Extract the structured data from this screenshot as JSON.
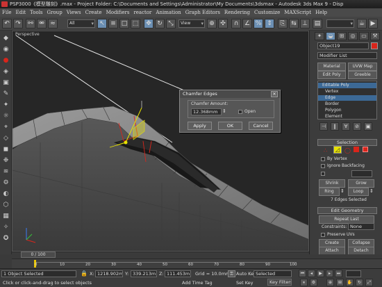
{
  "window": {
    "title": "PSP3000《模型雕刻》.max  - Project Folder: C:\\Documents and Settings\\Administrator\\My Documents\\3dsmax  - Autodesk 3ds Max 9  - Disp"
  },
  "menu": [
    "File",
    "Edit",
    "Tools",
    "Group",
    "Views",
    "Create",
    "Modifiers",
    "reactor",
    "Animation",
    "Graph Editors",
    "Rendering",
    "Customize",
    "MAXScript",
    "Help"
  ],
  "toolbar": {
    "selection_filter": "All",
    "ref_coord": "View"
  },
  "viewport": {
    "label": "Perspective"
  },
  "dialog": {
    "title": "Chamfer Edges",
    "amount_label": "Chamfer Amount:",
    "amount_value": "12.368mm",
    "open_label": "Open",
    "apply_label": "Apply",
    "ok_label": "OK",
    "cancel_label": "Cancel"
  },
  "panel": {
    "object_name": "Object19",
    "modifier_list": "Modifier List",
    "buttons": {
      "material": "Material",
      "uvw_map": "UVW Map",
      "edit_poly": "Edit Poly",
      "greeble": "Greeble"
    },
    "stack": [
      "Editable Poly",
      "Vertex",
      "Edge",
      "Border",
      "Polygon",
      "Element"
    ],
    "selection": {
      "header": "Selection",
      "by_vertex": "By Vertex",
      "ignore_backfacing": "Ignore Backfacing",
      "shrink": "Shrink",
      "grow": "Grow",
      "ring": "Ring",
      "loop": "Loop",
      "status": "7 Edges Selected"
    },
    "edit_geometry": {
      "header": "Edit Geometry",
      "repeat_last": "Repeat Last",
      "constraints_label": "Constraints:",
      "constraints_value": "None",
      "preserve_uvs": "Preserve UVs",
      "create": "Create",
      "collapse": "Collapse",
      "attach": "Attach",
      "detach": "Detach",
      "slice_plane": "Slice Plane",
      "split": "Split"
    }
  },
  "timeline": {
    "slider": "0 / 100",
    "ticks": [
      "0",
      "10",
      "20",
      "30",
      "40",
      "50",
      "60",
      "70",
      "80",
      "90",
      "100"
    ]
  },
  "status": {
    "selected": "1 Object Selected",
    "prompt": "Click or click-and-drag to select objects",
    "x_label": "X:",
    "x_value": "1218.902m",
    "y_label": "Y:",
    "y_value": "339.213m",
    "z_label": "Z:",
    "z_value": "111.453m",
    "grid": "Grid = 10.0mm",
    "add_time_tag": "Add Time Tag",
    "auto_key": "Auto Key",
    "set_key": "Set Key",
    "key_mode": "Selected",
    "key_filters": "Key Filters..."
  },
  "colors": {
    "selection_blue": "#3c6996",
    "dialog_bg": "#565656",
    "accent_red": "#d9251b",
    "gizmo_yellow": "#e8e200"
  }
}
